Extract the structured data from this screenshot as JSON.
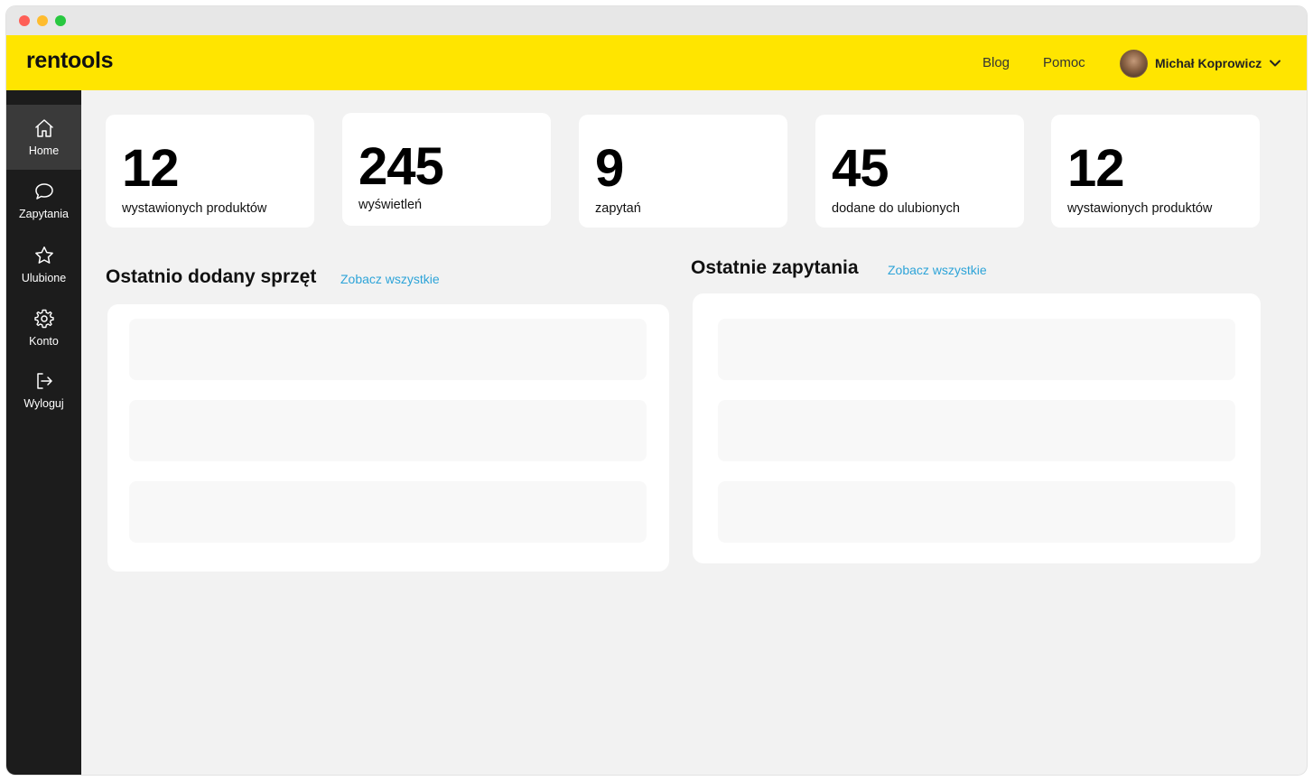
{
  "header": {
    "logo": "rentools",
    "nav": {
      "blog": "Blog",
      "help": "Pomoc"
    },
    "user": {
      "name": "Michał Koprowicz"
    },
    "background": "#ffe500"
  },
  "sidebar": {
    "items": [
      {
        "label": "Home",
        "icon": "home-icon",
        "active": true
      },
      {
        "label": "Zapytania",
        "icon": "chat-icon",
        "active": false
      },
      {
        "label": "Ulubione",
        "icon": "star-icon",
        "active": false
      },
      {
        "label": "Konto",
        "icon": "gear-icon",
        "active": false
      },
      {
        "label": "Wyloguj",
        "icon": "logout-icon",
        "active": false
      }
    ]
  },
  "stats": [
    {
      "value": "12",
      "label": "wystawionych produktów"
    },
    {
      "value": "245",
      "label": "wyświetleń"
    },
    {
      "value": "9",
      "label": "zapytań"
    },
    {
      "value": "45",
      "label": "dodane do ulubionych"
    },
    {
      "value": "12",
      "label": "wystawionych produktów"
    }
  ],
  "sections": {
    "recent_equipment": {
      "title": "Ostatnio dodany sprzęt",
      "link": "Zobacz wszystkie"
    },
    "recent_inquiries": {
      "title": "Ostatnie zapytania",
      "link": "Zobacz wszystkie"
    }
  },
  "colors": {
    "accent": "#ffe500",
    "link": "#2ea4d8",
    "sidebar": "#1c1c1c"
  }
}
